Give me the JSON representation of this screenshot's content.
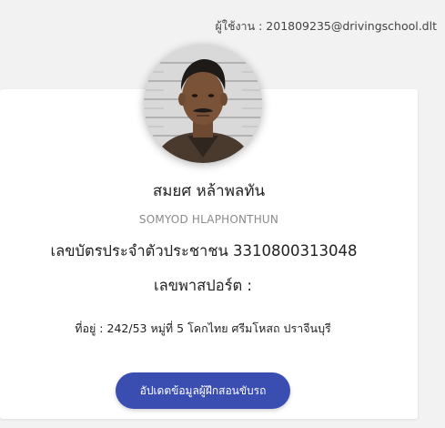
{
  "header": {
    "user_label": "ผู้ใช้งาน : 201809235@drivingschool.dlt"
  },
  "profile": {
    "name_th": "สมยศ หล้าพลทัน",
    "name_en": "SOMYOD HLAPHONTHUN",
    "id_card_label": "เลขบัตรประจำตัวประชาชน 3310800313048",
    "passport_label": "เลขพาสปอร์ต :",
    "address_label": "ที่อยู่ : 242/53 หมู่ที่ 5 โคกไทย ศรีมโหสถ ปราจีนบุรี"
  },
  "actions": {
    "update_button_label": "อัปเดตข้อมูลผู้ฝึกสอนขับรถ"
  },
  "colors": {
    "accent": "#3a4db0",
    "background": "#f2f2f2",
    "card": "#ffffff"
  }
}
